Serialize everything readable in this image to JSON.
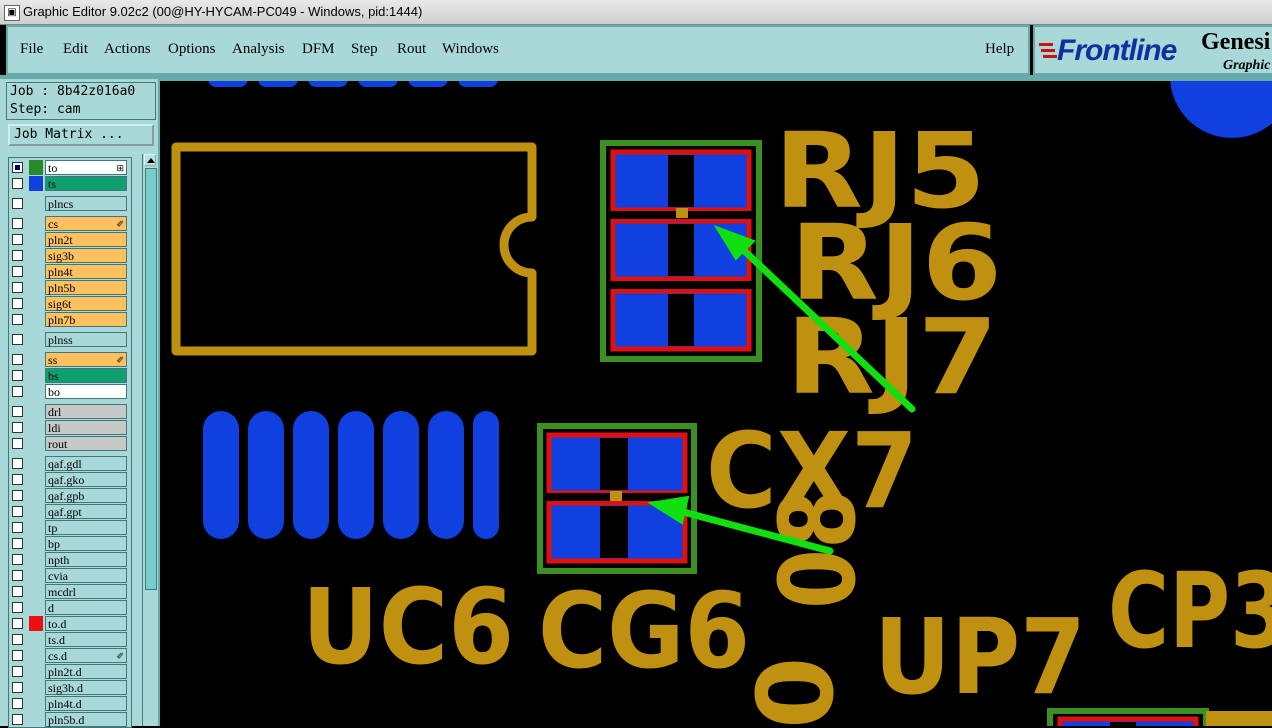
{
  "window": {
    "title": "Graphic Editor 9.02c2 (00@HY-HYCAM-PC049 - Windows, pid:1444)"
  },
  "menu": {
    "items": [
      "File",
      "Edit",
      "Actions",
      "Options",
      "Analysis",
      "DFM",
      "Step",
      "Rout",
      "Windows"
    ],
    "help": "Help"
  },
  "logo": {
    "brand": "Frontline",
    "product": "Genesi",
    "sub": "Graphic"
  },
  "job": {
    "job_line": "Job : 8b42z016a0",
    "step_line": "Step: cam",
    "matrix_button": "Job Matrix ..."
  },
  "layers": [
    {
      "name": "to",
      "color": "#ffffff",
      "swatch": "#2a8a2a",
      "checked": true,
      "mark": "⊞"
    },
    {
      "name": "ts",
      "color": "#10a070",
      "swatch": "#1040e0",
      "checked": false,
      "mark": ""
    },
    {
      "name": "plncs",
      "color": "#a8d8d8",
      "swatch": "",
      "checked": false,
      "mark": ""
    },
    {
      "name": "cs",
      "color": "#ffc060",
      "swatch": "",
      "checked": false,
      "mark": "✐"
    },
    {
      "name": "pln2t",
      "color": "#ffc060",
      "swatch": "",
      "checked": false,
      "mark": ""
    },
    {
      "name": "sig3b",
      "color": "#ffc060",
      "swatch": "",
      "checked": false,
      "mark": ""
    },
    {
      "name": "pln4t",
      "color": "#ffc060",
      "swatch": "",
      "checked": false,
      "mark": ""
    },
    {
      "name": "pln5b",
      "color": "#ffc060",
      "swatch": "",
      "checked": false,
      "mark": ""
    },
    {
      "name": "sig6t",
      "color": "#ffc060",
      "swatch": "",
      "checked": false,
      "mark": ""
    },
    {
      "name": "pln7b",
      "color": "#ffc060",
      "swatch": "",
      "checked": false,
      "mark": ""
    },
    {
      "name": "plnss",
      "color": "#a8d8d8",
      "swatch": "",
      "checked": false,
      "mark": ""
    },
    {
      "name": "ss",
      "color": "#ffc060",
      "swatch": "",
      "checked": false,
      "mark": "✐"
    },
    {
      "name": "bs",
      "color": "#10a070",
      "swatch": "",
      "checked": false,
      "mark": ""
    },
    {
      "name": "bo",
      "color": "#ffffff",
      "swatch": "",
      "checked": false,
      "mark": ""
    },
    {
      "name": "drl",
      "color": "#c8c8c8",
      "swatch": "",
      "checked": false,
      "mark": ""
    },
    {
      "name": "ldi",
      "color": "#c8c8c8",
      "swatch": "",
      "checked": false,
      "mark": ""
    },
    {
      "name": "rout",
      "color": "#c8c8c8",
      "swatch": "",
      "checked": false,
      "mark": ""
    },
    {
      "name": "qaf.gdl",
      "color": "#a8d8d8",
      "swatch": "",
      "checked": false,
      "mark": ""
    },
    {
      "name": "qaf.gko",
      "color": "#a8d8d8",
      "swatch": "",
      "checked": false,
      "mark": ""
    },
    {
      "name": "qaf.gpb",
      "color": "#a8d8d8",
      "swatch": "",
      "checked": false,
      "mark": ""
    },
    {
      "name": "qaf.gpt",
      "color": "#a8d8d8",
      "swatch": "",
      "checked": false,
      "mark": ""
    },
    {
      "name": "tp",
      "color": "#a8d8d8",
      "swatch": "",
      "checked": false,
      "mark": ""
    },
    {
      "name": "bp",
      "color": "#a8d8d8",
      "swatch": "",
      "checked": false,
      "mark": ""
    },
    {
      "name": "npth",
      "color": "#a8d8d8",
      "swatch": "",
      "checked": false,
      "mark": ""
    },
    {
      "name": "cvia",
      "color": "#a8d8d8",
      "swatch": "",
      "checked": false,
      "mark": ""
    },
    {
      "name": "mcdrl",
      "color": "#a8d8d8",
      "swatch": "",
      "checked": false,
      "mark": ""
    },
    {
      "name": "d",
      "color": "#a8d8d8",
      "swatch": "",
      "checked": false,
      "mark": ""
    },
    {
      "name": "to.d",
      "color": "#a8d8d8",
      "swatch": "#ee1010",
      "checked": false,
      "mark": ""
    },
    {
      "name": "ts.d",
      "color": "#a8d8d8",
      "swatch": "",
      "checked": false,
      "mark": ""
    },
    {
      "name": "cs.d",
      "color": "#a8d8d8",
      "swatch": "",
      "checked": false,
      "mark": "✐"
    },
    {
      "name": "pln2t.d",
      "color": "#a8d8d8",
      "swatch": "",
      "checked": false,
      "mark": ""
    },
    {
      "name": "sig3b.d",
      "color": "#a8d8d8",
      "swatch": "",
      "checked": false,
      "mark": ""
    },
    {
      "name": "pln4t.d",
      "color": "#a8d8d8",
      "swatch": "",
      "checked": false,
      "mark": ""
    },
    {
      "name": "pln5b.d",
      "color": "#a8d8d8",
      "swatch": "",
      "checked": false,
      "mark": ""
    }
  ],
  "canvas": {
    "refdes": [
      "RJ5",
      "RJ6",
      "RJ7",
      "CX7",
      "UC6",
      "CG6",
      "UP7",
      "CP3",
      "08",
      "0"
    ],
    "colors": {
      "silk": "#c09010",
      "copper": "#1040e0",
      "mask_outline": "#e01010",
      "green": "#3a9020",
      "arrow": "#10e010",
      "background": "#000000"
    }
  }
}
